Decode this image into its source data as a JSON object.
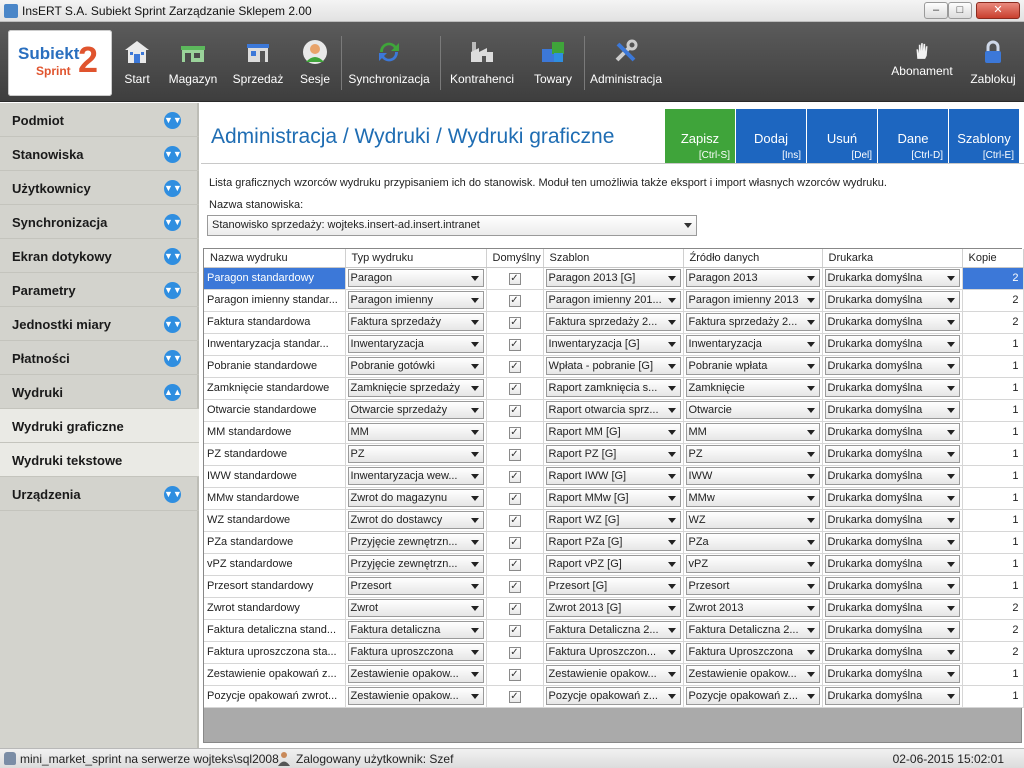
{
  "window": {
    "title": "InsERT S.A. Subiekt Sprint Zarządzanie Sklepem 2.00",
    "min": "–",
    "max": "□",
    "close": "✕"
  },
  "logo": {
    "brand": "Subiekt",
    "sub": "Sprint",
    "num": "2"
  },
  "toolbar": {
    "items": [
      {
        "label": "Start",
        "icon": "home-icon"
      },
      {
        "label": "Magazyn",
        "icon": "warehouse-icon"
      },
      {
        "label": "Sprzedaż",
        "icon": "shop-icon"
      },
      {
        "label": "Sesje",
        "icon": "user-session-icon"
      },
      {
        "label": "Synchronizacja",
        "icon": "sync-icon"
      },
      {
        "label": "Kontrahenci",
        "icon": "factory-icon"
      },
      {
        "label": "Towary",
        "icon": "boxes-icon"
      },
      {
        "label": "Administracja",
        "icon": "tools-icon"
      },
      {
        "label": "Abonament",
        "icon": "hand-icon"
      },
      {
        "label": "Zablokuj",
        "icon": "lock-icon"
      }
    ]
  },
  "sidebar": {
    "items": [
      {
        "label": "Podmiot"
      },
      {
        "label": "Stanowiska"
      },
      {
        "label": "Użytkownicy"
      },
      {
        "label": "Synchronizacja"
      },
      {
        "label": "Ekran dotykowy"
      },
      {
        "label": "Parametry"
      },
      {
        "label": "Jednostki miary"
      },
      {
        "label": "Płatności"
      },
      {
        "label": "Wydruki"
      },
      {
        "label": "Wydruki graficzne"
      },
      {
        "label": "Wydruki tekstowe"
      },
      {
        "label": "Urządzenia"
      }
    ]
  },
  "page": {
    "title": "Administracja / Wydruki / Wydruki graficzne",
    "description": "Lista graficznych wzorców wydruku przypisaniem ich do stanowisk. Moduł ten umożliwia także eksport i import własnych wzorców wydruku.",
    "station_label": "Nazwa stanowiska:",
    "station_value": "Stanowisko sprzedaży: wojteks.insert-ad.insert.intranet"
  },
  "actions": [
    {
      "label": "Zapisz",
      "shortcut": "[Ctrl-S]",
      "color": "#3fa43a"
    },
    {
      "label": "Dodaj",
      "shortcut": "[Ins]",
      "color": "#1d66c0"
    },
    {
      "label": "Usuń",
      "shortcut": "[Del]",
      "color": "#1d66c0"
    },
    {
      "label": "Dane",
      "shortcut": "[Ctrl-D]",
      "color": "#1d66c0"
    },
    {
      "label": "Szablony",
      "shortcut": "[Ctrl-E]",
      "color": "#1d66c0"
    }
  ],
  "table": {
    "headers": [
      "Nazwa wydruku",
      "Typ wydruku",
      "Domyślny",
      "Szablon",
      "Źródło danych",
      "Drukarka",
      "Kopie"
    ],
    "rows": [
      [
        "Paragon standardowy",
        "Paragon",
        "✓",
        "Paragon 2013 [G]",
        "Paragon 2013",
        "Drukarka domyślna",
        "2"
      ],
      [
        "Paragon imienny standar...",
        "Paragon imienny",
        "✓",
        "Paragon imienny 201...",
        "Paragon imienny 2013",
        "Drukarka domyślna",
        "2"
      ],
      [
        "Faktura standardowa",
        "Faktura sprzedaży",
        "✓",
        "Faktura sprzedaży 2...",
        "Faktura sprzedaży 2...",
        "Drukarka domyślna",
        "2"
      ],
      [
        "Inwentaryzacja standar...",
        "Inwentaryzacja",
        "✓",
        "Inwentaryzacja [G]",
        "Inwentaryzacja",
        "Drukarka domyślna",
        "1"
      ],
      [
        "Pobranie standardowe",
        "Pobranie gotówki",
        "✓",
        "Wpłata - pobranie [G]",
        "Pobranie wpłata",
        "Drukarka domyślna",
        "1"
      ],
      [
        "Zamknięcie standardowe",
        "Zamknięcie sprzedaży",
        "✓",
        "Raport zamknięcia s...",
        "Zamknięcie",
        "Drukarka domyślna",
        "1"
      ],
      [
        "Otwarcie standardowe",
        "Otwarcie sprzedaży",
        "✓",
        "Raport otwarcia sprz...",
        "Otwarcie",
        "Drukarka domyślna",
        "1"
      ],
      [
        "MM standardowe",
        "MM",
        "✓",
        "Raport MM [G]",
        "MM",
        "Drukarka domyślna",
        "1"
      ],
      [
        "PZ standardowe",
        "PZ",
        "✓",
        "Raport PZ [G]",
        "PZ",
        "Drukarka domyślna",
        "1"
      ],
      [
        "IWW standardowe",
        "Inwentaryzacja wew...",
        "✓",
        "Raport IWW [G]",
        "IWW",
        "Drukarka domyślna",
        "1"
      ],
      [
        "MMw standardowe",
        "Zwrot do magazynu",
        "✓",
        "Raport MMw [G]",
        "MMw",
        "Drukarka domyślna",
        "1"
      ],
      [
        "WZ standardowe",
        "Zwrot do dostawcy",
        "✓",
        "Raport WZ [G]",
        "WZ",
        "Drukarka domyślna",
        "1"
      ],
      [
        "PZa standardowe",
        "Przyjęcie zewnętrzn...",
        "✓",
        "Raport PZa [G]",
        "PZa",
        "Drukarka domyślna",
        "1"
      ],
      [
        "vPZ standardowe",
        "Przyjęcie zewnętrzn...",
        "✓",
        "Raport vPZ [G]",
        "vPZ",
        "Drukarka domyślna",
        "1"
      ],
      [
        "Przesort standardowy",
        "Przesort",
        "✓",
        "Przesort [G]",
        "Przesort",
        "Drukarka domyślna",
        "1"
      ],
      [
        "Zwrot standardowy",
        "Zwrot",
        "✓",
        "Zwrot 2013 [G]",
        "Zwrot 2013",
        "Drukarka domyślna",
        "2"
      ],
      [
        "Faktura detaliczna stand...",
        "Faktura detaliczna",
        "✓",
        "Faktura Detaliczna 2...",
        "Faktura Detaliczna 2...",
        "Drukarka domyślna",
        "2"
      ],
      [
        "Faktura uproszczona sta...",
        "Faktura uproszczona",
        "✓",
        "Faktura Uproszczon...",
        "Faktura Uproszczona",
        "Drukarka domyślna",
        "2"
      ],
      [
        "Zestawienie opakowań z...",
        "Zestawienie opakow...",
        "✓",
        "Zestawienie opakow...",
        "Zestawienie opakow...",
        "Drukarka domyślna",
        "1"
      ],
      [
        "Pozycje opakowań zwrot...",
        "Zestawienie opakow...",
        "✓",
        "Pozycje opakowań z...",
        "Pozycje opakowań z...",
        "Drukarka domyślna",
        "1"
      ]
    ]
  },
  "status": {
    "connection": "mini_market_sprint na serwerze wojteks\\sql2008",
    "user": "Zalogowany użytkownik:  Szef",
    "datetime": "02-06-2015 15:02:01"
  }
}
